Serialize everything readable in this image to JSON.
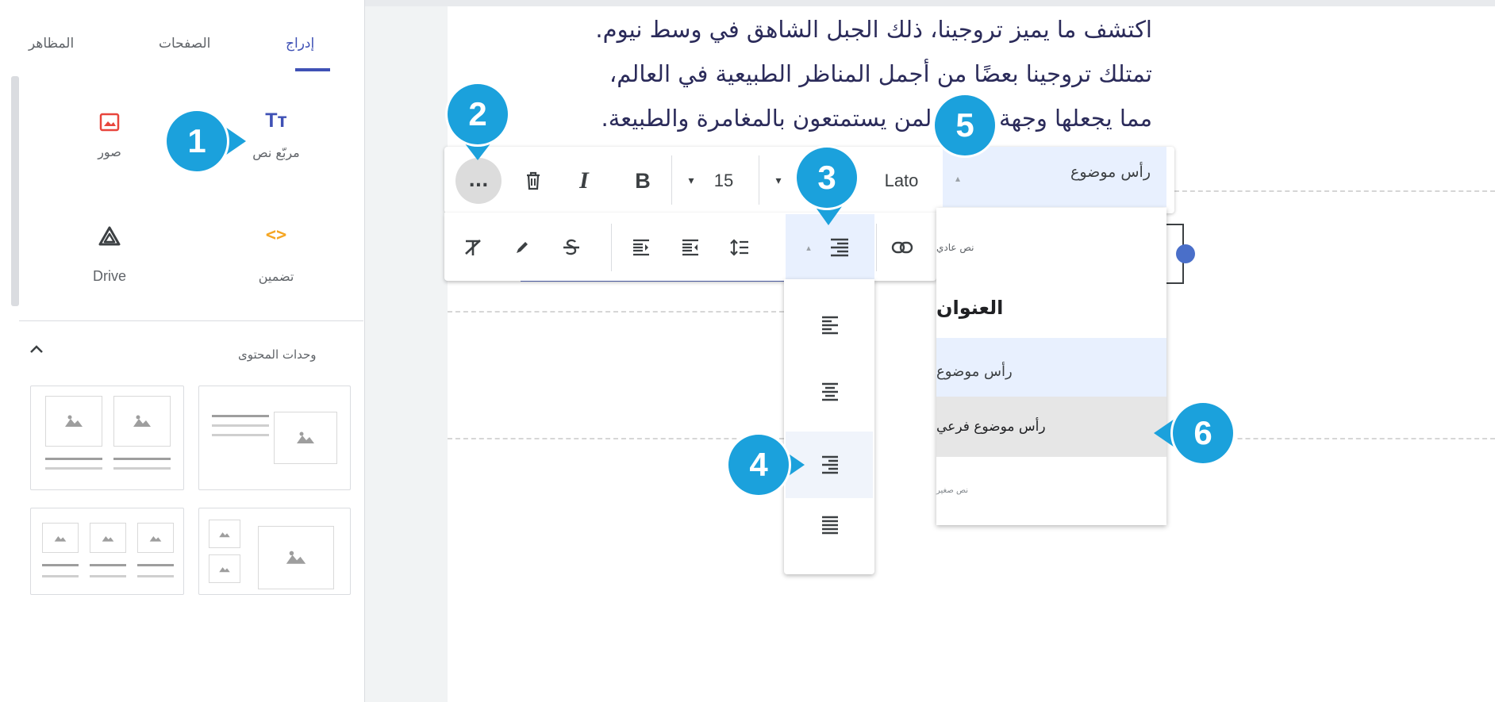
{
  "sidebar": {
    "tabs": [
      {
        "label": "إدراج",
        "active": true
      },
      {
        "label": "الصفحات",
        "active": false
      },
      {
        "label": "المظاهر",
        "active": false
      }
    ],
    "insert_items": [
      {
        "label": "مربّع نص",
        "icon": "text-box-icon",
        "glyph": "Tт"
      },
      {
        "label": "صور",
        "icon": "image-icon"
      },
      {
        "label": "تضمين",
        "icon": "embed-icon",
        "glyph": "<>"
      },
      {
        "label": "Drive",
        "icon": "drive-icon"
      }
    ],
    "content_blocks_label": "وحدات المحتوى"
  },
  "document": {
    "lines": [
      "اكتشف ما يميز تروجينا، ذلك الجبل الشاهق في وسط نيوم.",
      "تمتلك تروجينا بعضًا من أجمل المناظر الطبيعية في العالم،",
      "مما يجعلها وجهة مثالية لمن يستمتعون بالمغامرة والطبيعة."
    ]
  },
  "toolbar": {
    "more_label": "...",
    "bold_label": "B",
    "italic_label": "I",
    "font_size": "15",
    "font_name": "Lato",
    "heading_value": "رأس موضوع"
  },
  "heading_menu": {
    "items": [
      {
        "label": "نص عادي",
        "style": "normal"
      },
      {
        "label": "العنوان",
        "style": "title"
      },
      {
        "label": "رأس موضوع",
        "style": "heading",
        "selected": true
      },
      {
        "label": "رأس موضوع فرعي",
        "style": "subheading",
        "hovered": true
      },
      {
        "label": "نص صغير",
        "style": "small"
      }
    ]
  },
  "align_menu": {
    "options": [
      "align-left",
      "align-center",
      "align-right",
      "align-justify"
    ],
    "hovered": "align-right"
  },
  "callouts": [
    "1",
    "2",
    "3",
    "4",
    "5",
    "6"
  ],
  "colors": {
    "accent": "#3f51b5",
    "callout": "#1ba1dc",
    "selected_bg": "#e8f0fe",
    "hover_bg": "#e6e6e6",
    "image_icon_red": "#e8453c",
    "embed_icon_orange": "#f5a623"
  }
}
